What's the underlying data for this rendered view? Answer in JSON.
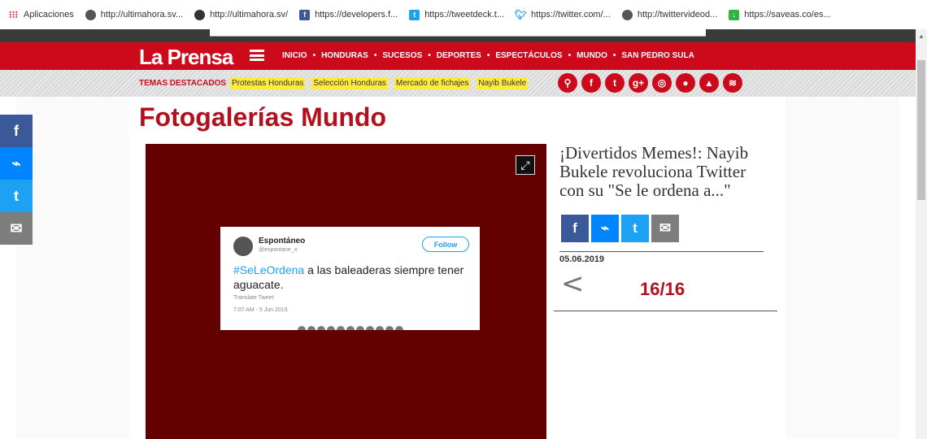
{
  "bookmarks": [
    {
      "label": "Aplicaciones",
      "icon": "apps-icon"
    },
    {
      "label": "http://ultimahora.sv...",
      "icon": "globe-icon"
    },
    {
      "label": "http://ultimahora.sv/",
      "icon": "clock-icon"
    },
    {
      "label": "https://developers.f...",
      "icon": "facebook-icon"
    },
    {
      "label": "https://tweetdeck.t...",
      "icon": "tweetdeck-icon"
    },
    {
      "label": "https://twitter.com/...",
      "icon": "twitter-icon"
    },
    {
      "label": "http://twittervideod...",
      "icon": "globe-icon"
    },
    {
      "label": "https://saveas.co/es...",
      "icon": "download-icon"
    }
  ],
  "site": {
    "logo": "La Prensa",
    "menu": [
      "INICIO",
      "HONDURAS",
      "SUCESOS",
      "DEPORTES",
      "ESPECTÁCULOS",
      "MUNDO",
      "SAN PEDRO SULA"
    ],
    "menu_separator": "•",
    "topics_title": "TEMAS DESTACADOS",
    "tags": [
      "Protestas Honduras",
      "Selección Honduras",
      "Mercado de fichajes",
      "Nayib Bukele"
    ],
    "social_icons": [
      "search-icon",
      "facebook-icon",
      "twitter-icon",
      "googleplus-icon",
      "instagram-icon",
      "apple-icon",
      "android-icon",
      "rss-icon"
    ],
    "brand_color": "#cc0a1c"
  },
  "section_title": "Fotogalerías Mundo",
  "left_share": [
    {
      "icon": "facebook-icon",
      "glyph": "f",
      "color": "#3b5998"
    },
    {
      "icon": "messenger-icon",
      "glyph": "m",
      "color": "#0084ff"
    },
    {
      "icon": "twitter-icon",
      "glyph": "t",
      "color": "#1da1f2"
    },
    {
      "icon": "email-icon",
      "glyph": "✉",
      "color": "#7d7d7d"
    }
  ],
  "gallery": {
    "bg_color": "#630000",
    "tweet": {
      "name": "Espontáneo",
      "handle": "@espontane_o",
      "follow": "Follow",
      "hashtag": "#SeLeOrdena",
      "text": " a las baleaderas siempre tener aguacate.",
      "translate": "Translate Tweet",
      "time": "7:07 AM - 5 Jun 2019"
    }
  },
  "article": {
    "headline": "¡Divertidos Memes!: Nayib Bukele revoluciona Twitter con su \"Se le ordena a...\"",
    "date": "05.06.2019",
    "prev_glyph": "<",
    "counter": "16/16"
  },
  "share_row": [
    {
      "icon": "facebook-icon",
      "glyph": "f",
      "color": "#3b5998"
    },
    {
      "icon": "messenger-icon",
      "glyph": "m",
      "color": "#0084ff"
    },
    {
      "icon": "twitter-icon",
      "glyph": "t",
      "color": "#1da1f2"
    },
    {
      "icon": "email-icon",
      "glyph": "✉",
      "color": "#7d7d7d"
    }
  ]
}
